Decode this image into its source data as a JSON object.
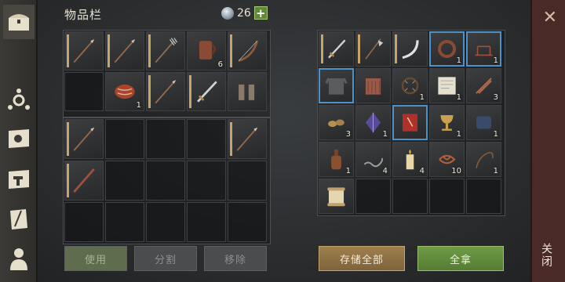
{
  "title": "物品栏",
  "currency": {
    "amount": "26",
    "plus_label": "+"
  },
  "buttons": {
    "use": "使用",
    "split": "分割",
    "remove": "移除",
    "store_all": "存储全部",
    "take_all": "全拿"
  },
  "close": {
    "label": "关闭",
    "x": "✕"
  },
  "left_grid_top": [
    {
      "item": "spear",
      "count": ""
    },
    {
      "item": "spear",
      "count": ""
    },
    {
      "item": "pitchfork",
      "count": ""
    },
    {
      "item": "leather-jug",
      "count": "6"
    },
    {
      "item": "bow",
      "count": ""
    },
    {
      "item": "",
      "count": ""
    },
    {
      "item": "raw-meat",
      "count": "1"
    },
    {
      "item": "spear",
      "count": ""
    },
    {
      "item": "sword",
      "count": ""
    },
    {
      "item": "gloves",
      "count": ""
    }
  ],
  "left_grid_bottom": [
    {
      "item": "spear",
      "count": ""
    },
    {
      "item": "",
      "count": ""
    },
    {
      "item": "",
      "count": ""
    },
    {
      "item": "",
      "count": ""
    },
    {
      "item": "spear",
      "count": ""
    },
    {
      "item": "bloody-spear",
      "count": ""
    },
    {
      "item": "",
      "count": ""
    },
    {
      "item": "",
      "count": ""
    },
    {
      "item": "",
      "count": ""
    },
    {
      "item": "",
      "count": ""
    },
    {
      "item": "",
      "count": ""
    },
    {
      "item": "",
      "count": ""
    },
    {
      "item": "",
      "count": ""
    },
    {
      "item": "",
      "count": ""
    },
    {
      "item": "",
      "count": ""
    }
  ],
  "right_grid": [
    {
      "item": "sword",
      "count": "",
      "rare": false
    },
    {
      "item": "halberd",
      "count": "",
      "rare": false
    },
    {
      "item": "scimitar",
      "count": "",
      "rare": false
    },
    {
      "item": "belt",
      "count": "1",
      "rare": true
    },
    {
      "item": "trap",
      "count": "1",
      "rare": true
    },
    {
      "item": "chainmail",
      "count": "",
      "rare": true
    },
    {
      "item": "gambeson",
      "count": "",
      "rare": false
    },
    {
      "item": "bear-trap",
      "count": "1",
      "rare": false
    },
    {
      "item": "map",
      "count": "1",
      "rare": false
    },
    {
      "item": "bolts",
      "count": "3",
      "rare": false
    },
    {
      "item": "nuts",
      "count": "3",
      "rare": false
    },
    {
      "item": "crystal",
      "count": "1",
      "rare": false
    },
    {
      "item": "red-book",
      "count": "",
      "rare": true
    },
    {
      "item": "goblet",
      "count": "1",
      "rare": false
    },
    {
      "item": "gauntlets",
      "count": "1",
      "rare": false
    },
    {
      "item": "bottle",
      "count": "1",
      "rare": false
    },
    {
      "item": "chain",
      "count": "4",
      "rare": false
    },
    {
      "item": "candle",
      "count": "4",
      "rare": false
    },
    {
      "item": "rope-tangle",
      "count": "10",
      "rare": false
    },
    {
      "item": "whip",
      "count": "1",
      "rare": false
    },
    {
      "item": "scroll",
      "count": "",
      "rare": false
    },
    {
      "item": "",
      "count": "",
      "rare": false
    },
    {
      "item": "",
      "count": "",
      "rare": false
    },
    {
      "item": "",
      "count": "",
      "rare": false
    },
    {
      "item": "",
      "count": "",
      "rare": false
    }
  ],
  "sidebar": [
    "chest-icon",
    "faction-icon",
    "sun-map-icon",
    "build-map-icon",
    "recipe-icon",
    "character-icon"
  ]
}
